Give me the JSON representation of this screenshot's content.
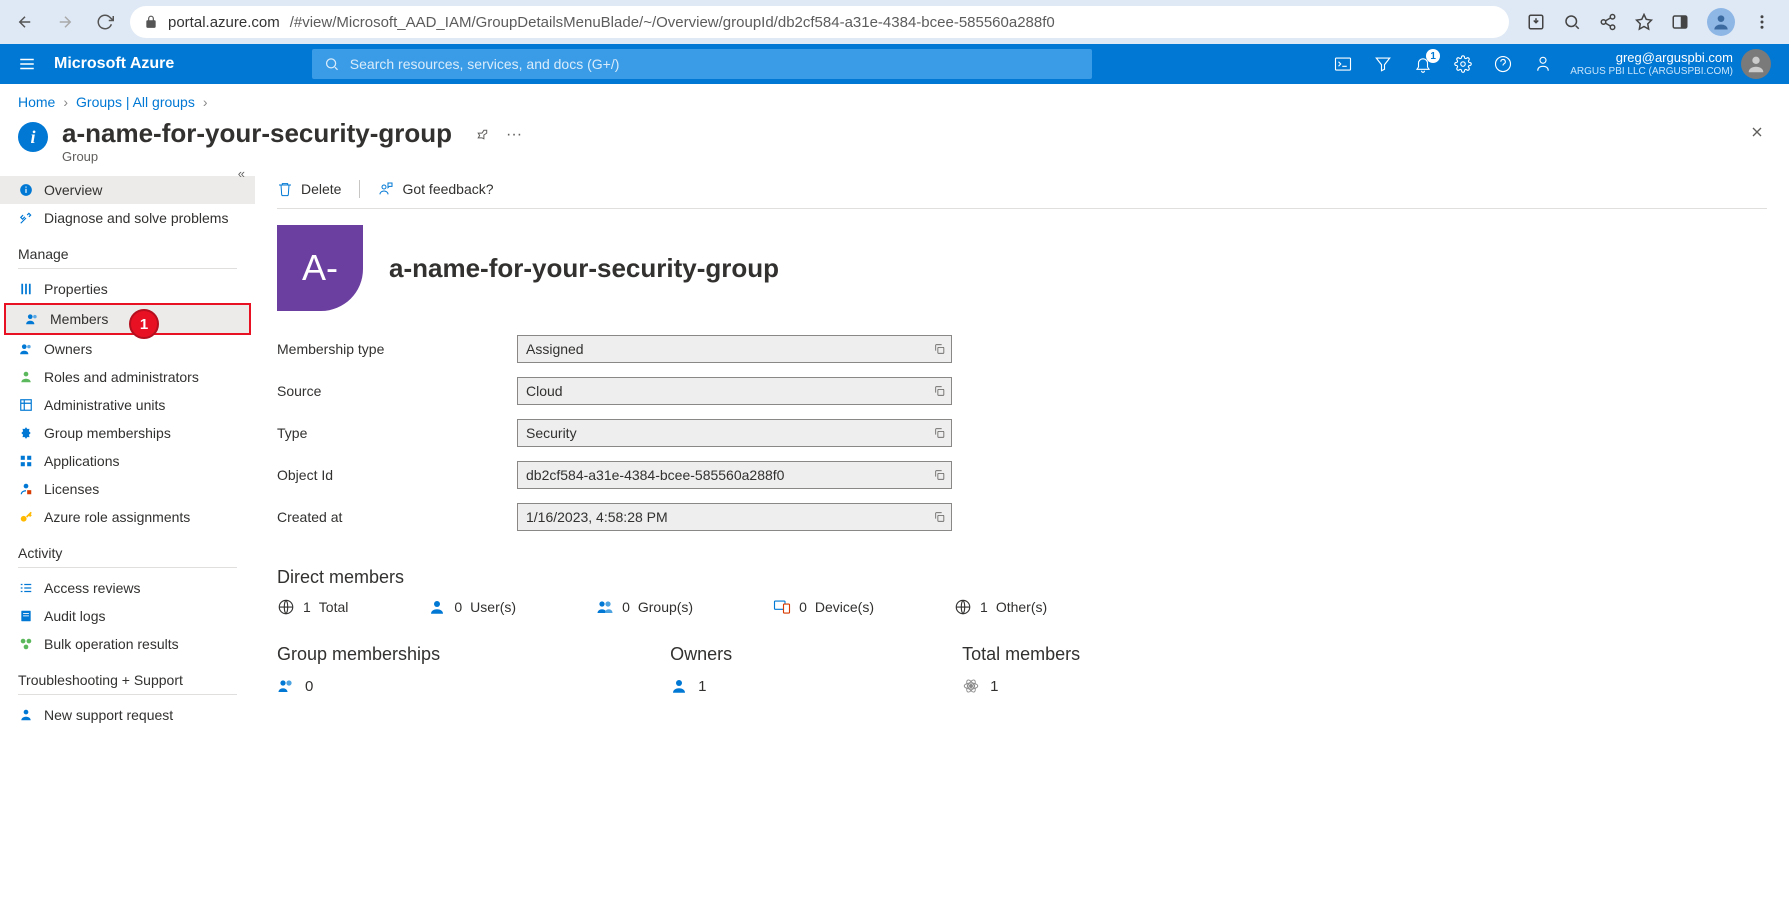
{
  "browser": {
    "url_host": "portal.azure.com",
    "url_path": "/#view/Microsoft_AAD_IAM/GroupDetailsMenuBlade/~/Overview/groupId/db2cf584-a31e-4384-bcee-585560a288f0"
  },
  "azure": {
    "brand": "Microsoft Azure",
    "search_placeholder": "Search resources, services, and docs (G+/)",
    "notification_badge": "1",
    "account": {
      "email": "greg@arguspbi.com",
      "tenant": "ARGUS PBI LLC (ARGUSPBI.COM)"
    }
  },
  "breadcrumb": {
    "home": "Home",
    "groups": "Groups | All groups"
  },
  "title": {
    "name": "a-name-for-your-security-group",
    "subtitle": "Group"
  },
  "sidebar": {
    "overview": "Overview",
    "diagnose": "Diagnose and solve problems",
    "manage_header": "Manage",
    "properties": "Properties",
    "members": "Members",
    "owners": "Owners",
    "roles": "Roles and administrators",
    "admin_units": "Administrative units",
    "group_memberships": "Group memberships",
    "applications": "Applications",
    "licenses": "Licenses",
    "azure_role": "Azure role assignments",
    "activity_header": "Activity",
    "access_reviews": "Access reviews",
    "audit_logs": "Audit logs",
    "bulk": "Bulk operation results",
    "troubleshoot_header": "Troubleshooting + Support",
    "support": "New support request"
  },
  "callout": "1",
  "commands": {
    "delete": "Delete",
    "feedback": "Got feedback?"
  },
  "hero": {
    "initials": "A-",
    "name": "a-name-for-your-security-group"
  },
  "properties": {
    "membership_type": {
      "label": "Membership type",
      "value": "Assigned"
    },
    "source": {
      "label": "Source",
      "value": "Cloud"
    },
    "type": {
      "label": "Type",
      "value": "Security"
    },
    "object_id": {
      "label": "Object Id",
      "value": "db2cf584-a31e-4384-bcee-585560a288f0"
    },
    "created_at": {
      "label": "Created at",
      "value": "1/16/2023, 4:58:28 PM"
    }
  },
  "direct_members": {
    "header": "Direct members",
    "total": {
      "count": "1",
      "label": "Total"
    },
    "users": {
      "count": "0",
      "label": "User(s)"
    },
    "groups": {
      "count": "0",
      "label": "Group(s)"
    },
    "devices": {
      "count": "0",
      "label": "Device(s)"
    },
    "others": {
      "count": "1",
      "label": "Other(s)"
    }
  },
  "bottom": {
    "group_memberships": {
      "header": "Group memberships",
      "value": "0"
    },
    "owners": {
      "header": "Owners",
      "value": "1"
    },
    "total_members": {
      "header": "Total members",
      "value": "1"
    }
  }
}
